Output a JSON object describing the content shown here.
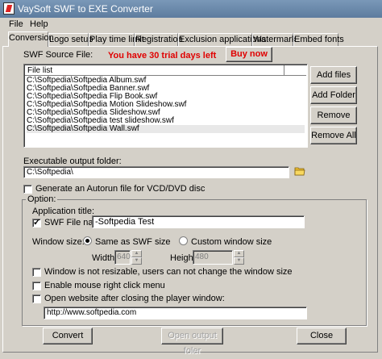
{
  "window": {
    "title": "VaySoft SWF to EXE Converter",
    "icon": "flash-app-icon"
  },
  "menu": [
    "File",
    "Help"
  ],
  "tabs": [
    "Conversion",
    "Logo setup",
    "Play time limit",
    "Registration",
    "Exclusion applications",
    "Watermark",
    "Embed fonts"
  ],
  "source": {
    "label": "SWF Source File:",
    "trial_notice": "You have 30 trial days left",
    "buy_label": "Buy now",
    "list_header": "File list",
    "files": [
      "C:\\Softpedia\\Softpedia Album.swf",
      "C:\\Softpedia\\Softpedia Banner.swf",
      "C:\\Softpedia\\Softpedia Flip Book.swf",
      "C:\\Softpedia\\Softpedia Motion Slideshow.swf",
      "C:\\Softpedia\\Softpedia Slideshow.swf",
      "C:\\Softpedia\\Softpedia test slideshow.swf",
      "C:\\Softpedia\\Softpedia Wall.swf"
    ],
    "buttons": {
      "add_files": "Add files",
      "add_folder": "Add Folder",
      "remove": "Remove",
      "remove_all": "Remove All"
    }
  },
  "output": {
    "label": "Executable output folder:",
    "value": "C:\\Softpedia\\",
    "autorun_label": "Generate an Autorun file for VCD/DVD disc",
    "autorun_checked": false
  },
  "option": {
    "legend": "Option:",
    "app_title_label": "Application title:",
    "swf_name_label": "SWF File name",
    "swf_name_checked": true,
    "title_value": "-Softpedia Test",
    "window_size_label": "Window size:",
    "same_as_swf_label": "Same as SWF size",
    "custom_label": "Custom window size",
    "width_label": "Width:",
    "width_value": "640",
    "height_label": "Height:",
    "height_value": "480",
    "not_resizable_label": "Window is not resizable, users can not change the window size",
    "right_click_label": "Enable mouse right click menu",
    "open_website_label": "Open website after closing the player window:",
    "website_value": "http://www.softpedia.com"
  },
  "footer": {
    "convert": "Convert",
    "open_output": "Open output foler",
    "close": "Close"
  },
  "colors": {
    "trial": "#e00000",
    "titlebar": "#6a8aaa",
    "face": "#d4d0c8"
  }
}
